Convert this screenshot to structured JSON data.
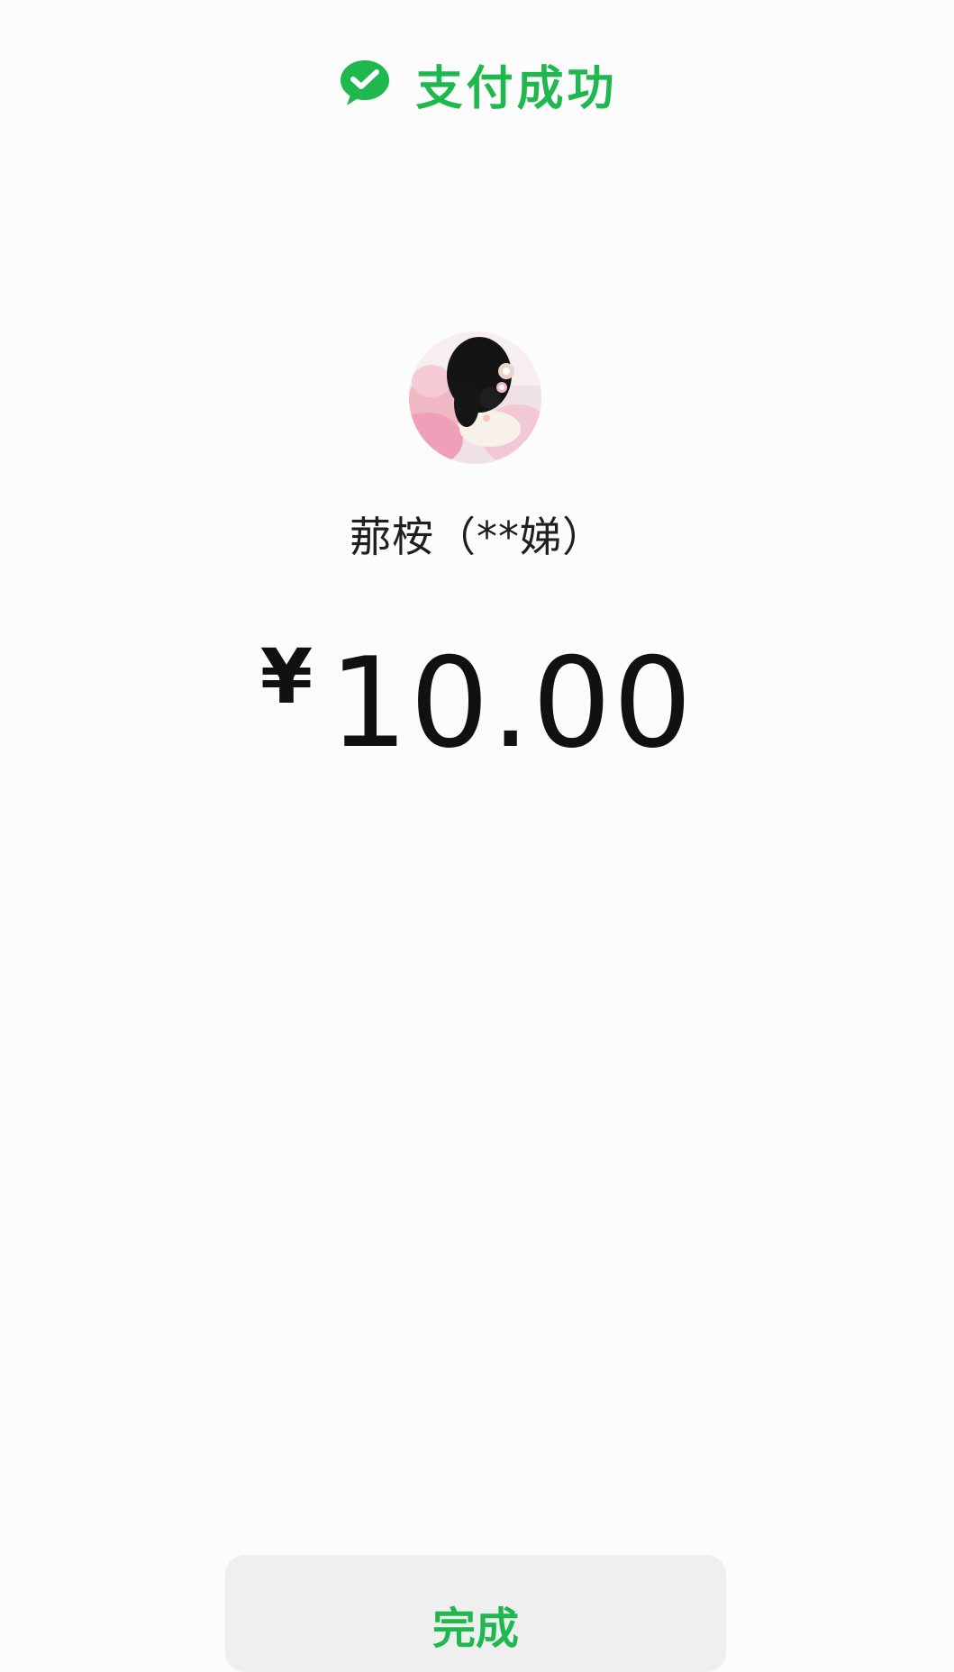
{
  "header": {
    "icon": "wechat-pay-icon",
    "title": "支付成功",
    "accent_color": "#1fb84f"
  },
  "payee": {
    "avatar": "avatar-photo",
    "name": "𦰡桉（**娣）"
  },
  "payment": {
    "currency_symbol": "¥",
    "amount": "10.00"
  },
  "actions": {
    "done_label": "完成"
  }
}
